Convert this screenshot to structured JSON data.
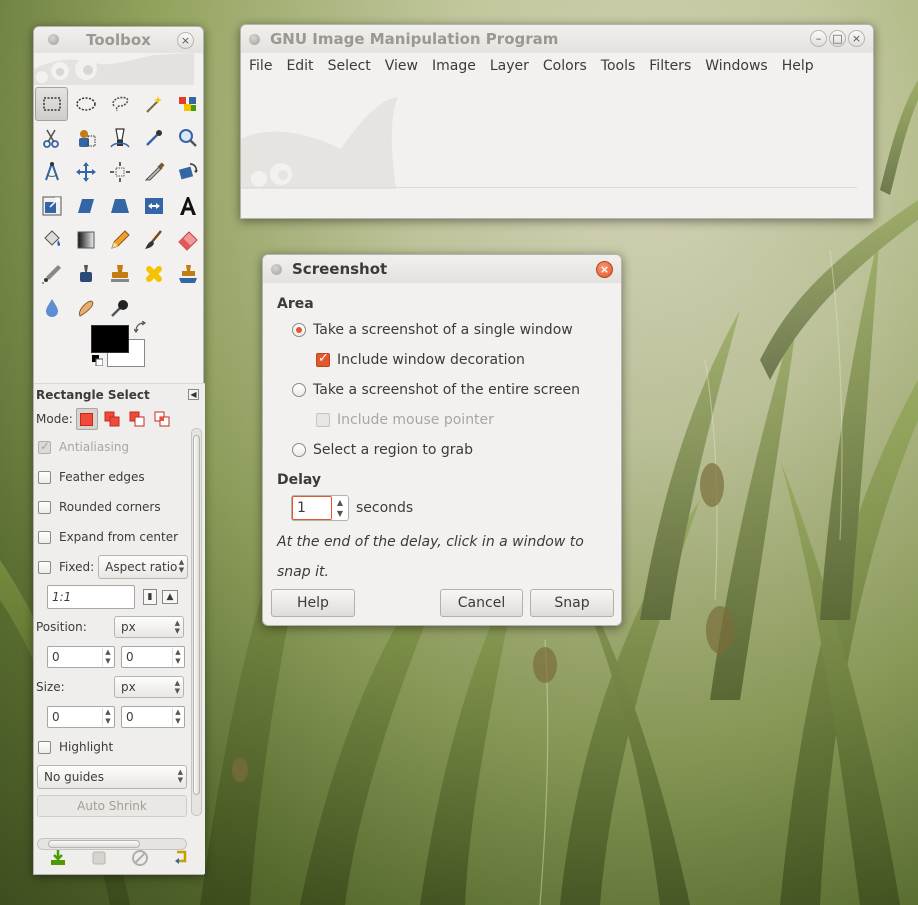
{
  "gimp": {
    "title": "GNU Image Manipulation Program",
    "menu": [
      "File",
      "Edit",
      "Select",
      "View",
      "Image",
      "Layer",
      "Colors",
      "Tools",
      "Filters",
      "Windows",
      "Help"
    ],
    "minimize_glyph": "–",
    "maximize_glyph": "□",
    "close_glyph": "×"
  },
  "toolbox": {
    "title": "Toolbox",
    "close_glyph": "×",
    "tools": [
      "rect-select",
      "ellipse-select",
      "free-select",
      "fuzzy-select",
      "color-select",
      "scissors-select",
      "foreground-select",
      "paths",
      "color-picker",
      "zoom",
      "measure",
      "move",
      "align",
      "crop",
      "rotate",
      "scale",
      "shear",
      "perspective",
      "flip",
      "text",
      "bucket-fill",
      "blend",
      "pencil",
      "paintbrush",
      "eraser",
      "airbrush",
      "ink",
      "clone",
      "heal",
      "perspective-clone",
      "blur",
      "smudge",
      "dodge-burn"
    ],
    "options": {
      "header": "Rectangle Select",
      "mode_label": "Mode:",
      "antialiasing": "Antialiasing",
      "feather_edges": "Feather edges",
      "rounded_corners": "Rounded corners",
      "expand_from_center": "Expand from center",
      "fixed_label": "Fixed:",
      "fixed_value": "Aspect ratio",
      "ratio_value": "1:1",
      "position_label": "Position:",
      "position_unit": "px",
      "pos_x": "0",
      "pos_y": "0",
      "size_label": "Size:",
      "size_unit": "px",
      "size_w": "0",
      "size_h": "0",
      "highlight": "Highlight",
      "guides": "No guides",
      "auto_shrink": "Auto Shrink"
    }
  },
  "screenshot": {
    "title": "Screenshot",
    "close_glyph": "×",
    "area_title": "Area",
    "opt_single_window": "Take a screenshot of a single window",
    "opt_include_decoration": "Include window decoration",
    "opt_entire_screen": "Take a screenshot of the entire screen",
    "opt_include_pointer": "Include mouse pointer",
    "opt_region": "Select a region to grab",
    "delay_title": "Delay",
    "delay_value": "1",
    "delay_unit": "seconds",
    "hint": "At the end of the delay, click in a window to snap it.",
    "help_label": "Help",
    "cancel_label": "Cancel",
    "snap_label": "Snap"
  },
  "colors": {
    "accent": "#e4572b",
    "window_bg": "#f2f1f0",
    "fg_color": "#000000",
    "bg_color": "#ffffff"
  }
}
